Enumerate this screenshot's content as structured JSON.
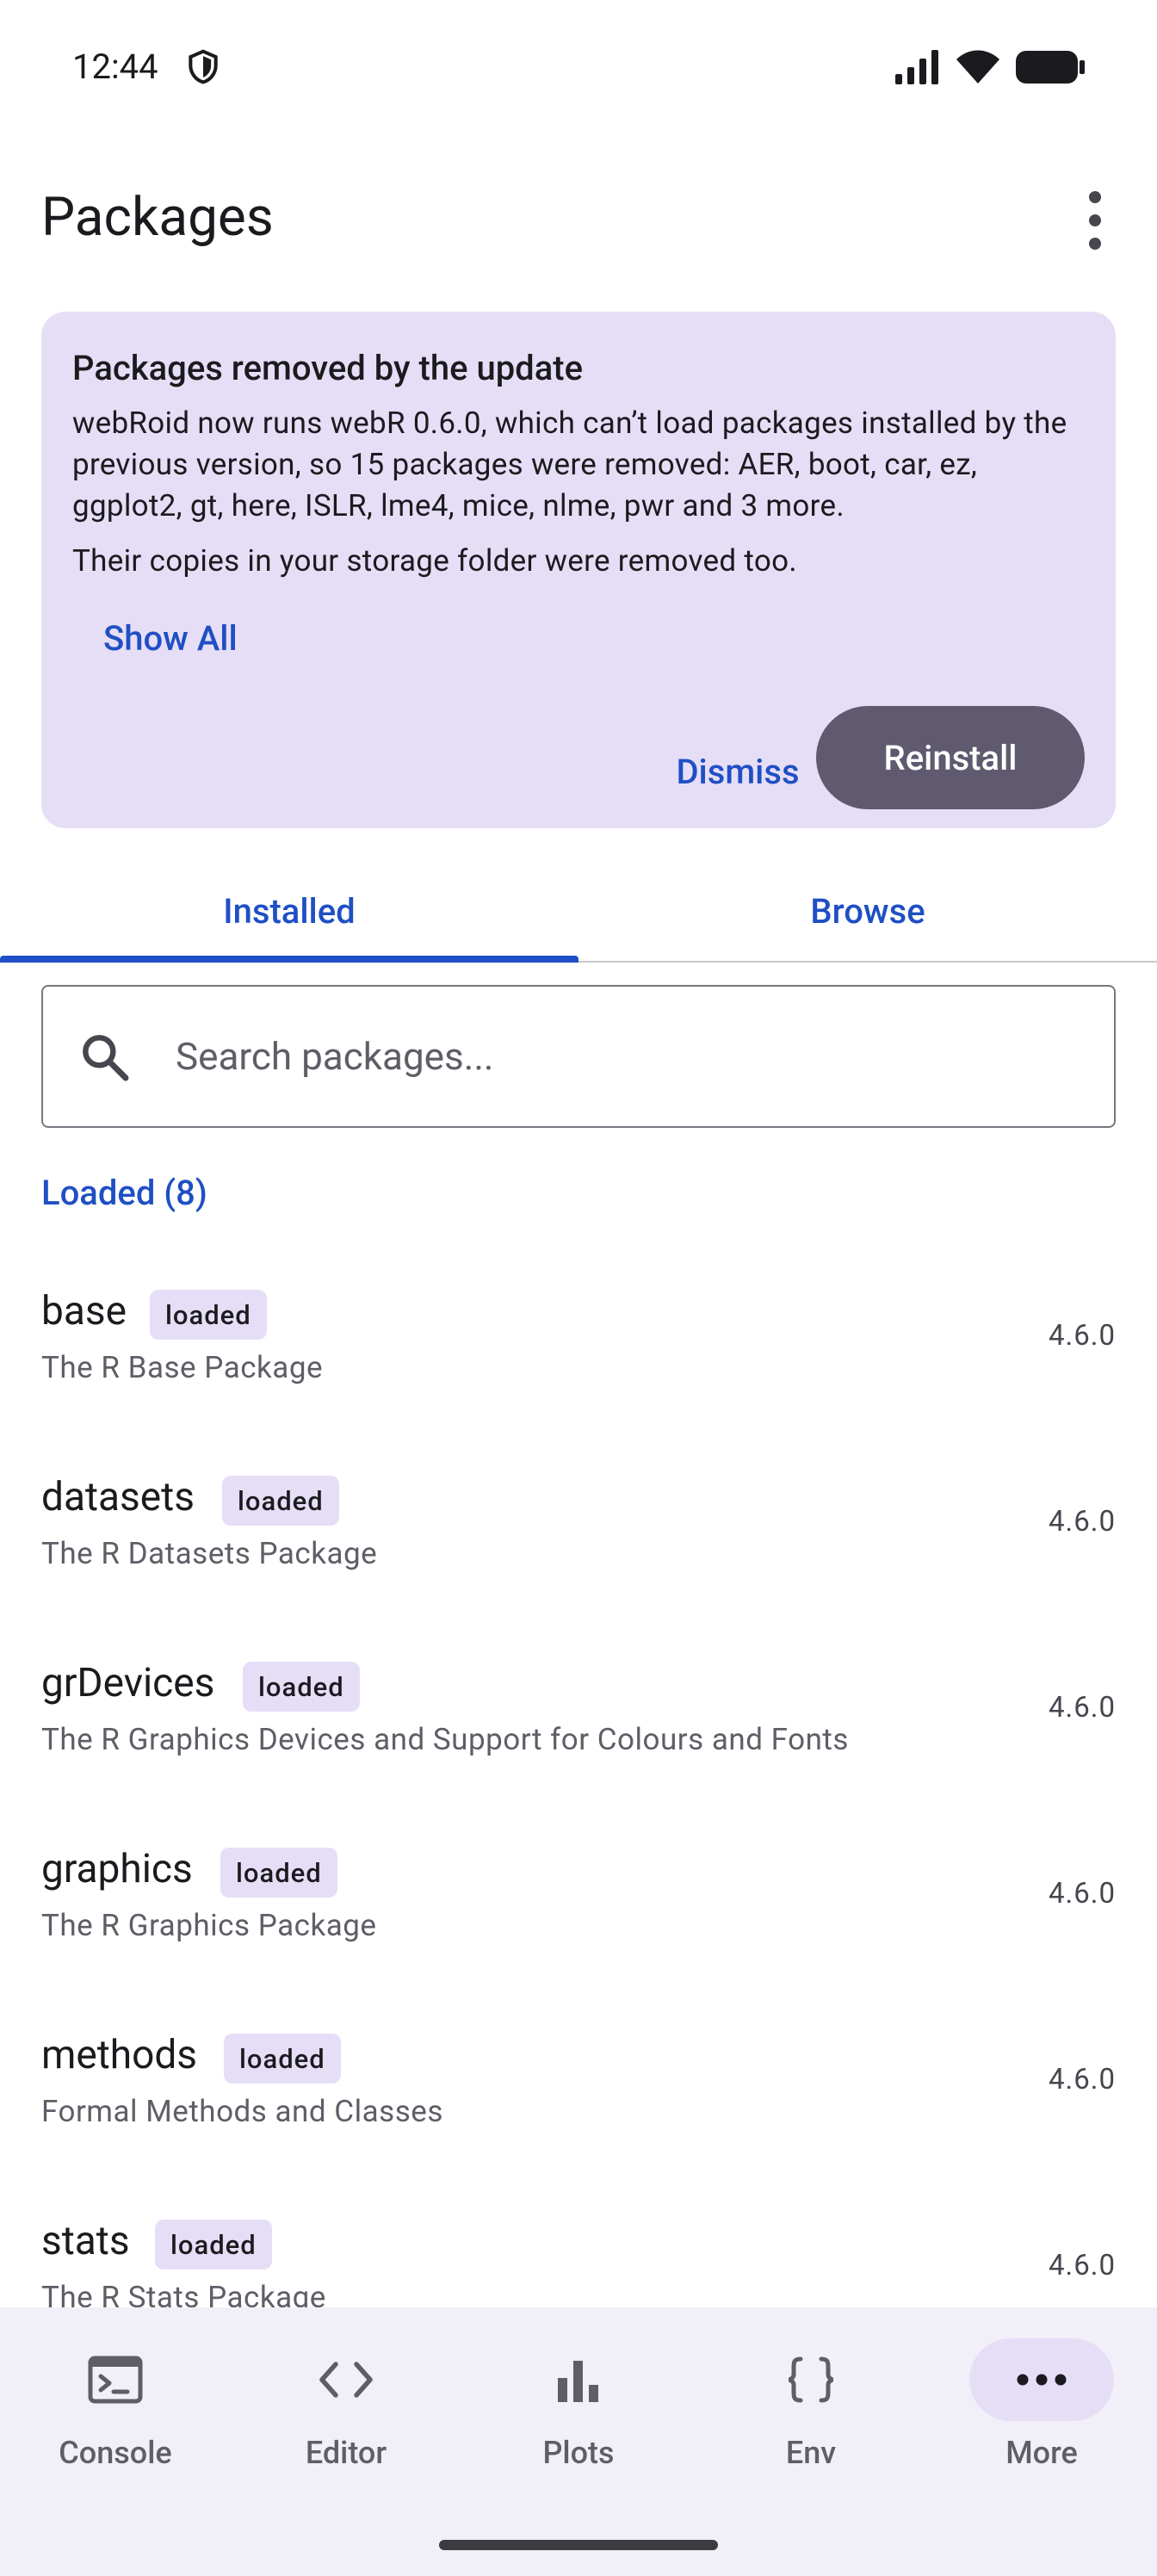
{
  "status_bar": {
    "time": "12:44"
  },
  "header": {
    "title": "Packages"
  },
  "banner": {
    "title": "Packages removed by the update",
    "body": "webRoid now runs webR 0.6.0, which can’t load packages installed by the previous version, so 15 packages were removed: AER, boot, car, ez, ggplot2, gt, here, ISLR, lme4, mice, nlme, pwr and 3 more.",
    "body2": "Their copies in your storage folder were removed too.",
    "show_all": "Show All",
    "dismiss": "Dismiss",
    "reinstall": "Reinstall"
  },
  "tabs": [
    {
      "label": "Installed",
      "active": true
    },
    {
      "label": "Browse",
      "active": false
    }
  ],
  "search": {
    "placeholder": "Search packages..."
  },
  "section": {
    "loaded_header": "Loaded (8)"
  },
  "packages": [
    {
      "name": "base",
      "badge": "loaded",
      "description": "The R Base Package",
      "version": "4.6.0"
    },
    {
      "name": "datasets",
      "badge": "loaded",
      "description": "The R Datasets Package",
      "version": "4.6.0"
    },
    {
      "name": "grDevices",
      "badge": "loaded",
      "description": "The R Graphics Devices and Support for Colours and Fonts",
      "version": "4.6.0"
    },
    {
      "name": "graphics",
      "badge": "loaded",
      "description": "The R Graphics Package",
      "version": "4.6.0"
    },
    {
      "name": "methods",
      "badge": "loaded",
      "description": "Formal Methods and Classes",
      "version": "4.6.0"
    },
    {
      "name": "stats",
      "badge": "loaded",
      "description": "The R Stats Package",
      "version": "4.6.0"
    }
  ],
  "bottom_nav": [
    {
      "label": "Console",
      "icon": "terminal-icon",
      "active": false
    },
    {
      "label": "Editor",
      "icon": "code-icon",
      "active": false
    },
    {
      "label": "Plots",
      "icon": "bar-chart-icon",
      "active": false
    },
    {
      "label": "Env",
      "icon": "braces-icon",
      "active": false
    },
    {
      "label": "More",
      "icon": "more-horiz-icon",
      "active": true
    }
  ],
  "colors": {
    "accent": "#1f4fc4",
    "banner_bg": "#e6def6",
    "reinstall_bg": "#605a70",
    "nav_bg": "#f1eff7"
  }
}
